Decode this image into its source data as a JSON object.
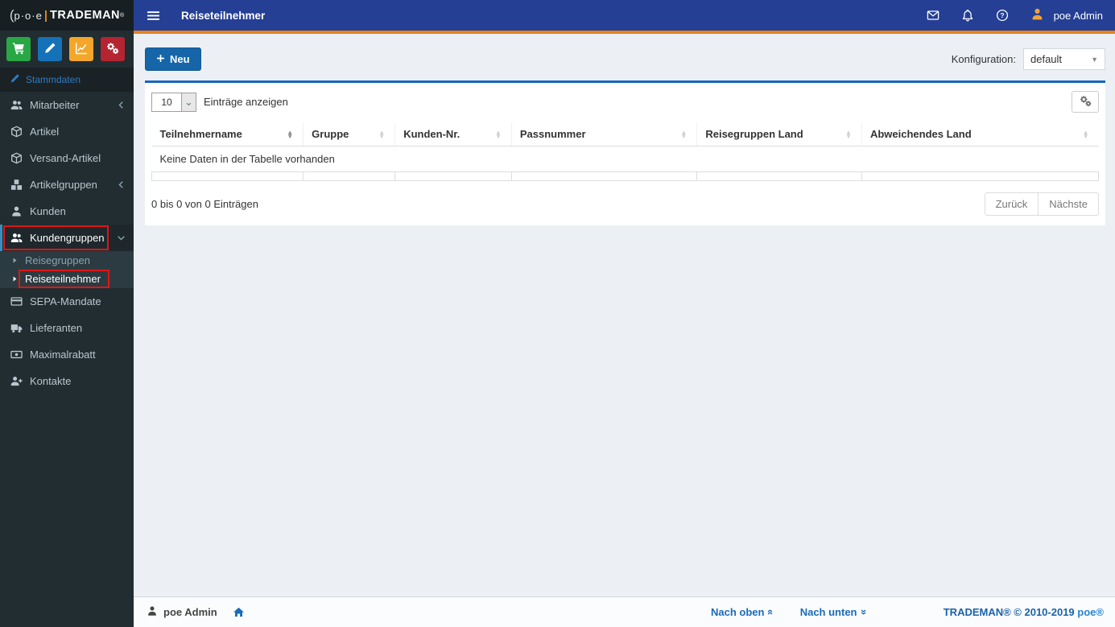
{
  "logo": {
    "paren": "(",
    "poe": "p·o·e",
    "brand": "TRADEMAN",
    "reg": "®"
  },
  "topbar": {
    "title": "Reiseteilnehmer",
    "user": "poe Admin",
    "icons": [
      "envelope-icon",
      "bell-icon",
      "question-icon"
    ]
  },
  "quick_buttons": [
    {
      "name": "cart-button",
      "icon": "cart",
      "color": "#2aa745"
    },
    {
      "name": "edit-button",
      "icon": "pencil",
      "color": "#1572b8"
    },
    {
      "name": "chart-button",
      "icon": "chart",
      "color": "#f4a62a"
    },
    {
      "name": "cogs-button",
      "icon": "cogs",
      "color": "#b52431"
    }
  ],
  "sidebar": {
    "header": "Stammdaten",
    "items": [
      {
        "label": "Mitarbeiter",
        "icon": "users",
        "chevron": "left"
      },
      {
        "label": "Artikel",
        "icon": "cube"
      },
      {
        "label": "Versand-Artikel",
        "icon": "cube"
      },
      {
        "label": "Artikelgruppen",
        "icon": "cubes",
        "chevron": "left"
      },
      {
        "label": "Kunden",
        "icon": "user"
      },
      {
        "label": "Kundengruppen",
        "icon": "users",
        "chevron": "down",
        "active": true,
        "annotated": true,
        "submenu": [
          {
            "label": "Reisegruppen"
          },
          {
            "label": "Reiseteilnehmer",
            "active": true,
            "annotated": true
          }
        ]
      },
      {
        "label": "SEPA-Mandate",
        "icon": "card"
      },
      {
        "label": "Lieferanten",
        "icon": "truck"
      },
      {
        "label": "Maximalrabatt",
        "icon": "money"
      },
      {
        "label": "Kontakte",
        "icon": "user-plus"
      }
    ]
  },
  "toolbar": {
    "new_label": "Neu",
    "config_label": "Konfiguration:",
    "config_value": "default"
  },
  "table": {
    "length_value": "10",
    "length_label": "Einträge anzeigen",
    "columns": [
      "Teilnehmername",
      "Gruppe",
      "Kunden-Nr.",
      "Passnummer",
      "Reisegruppen Land",
      "Abweichendes Land"
    ],
    "sorted_column": "Teilnehmername",
    "empty_text": "Keine Daten in der Tabelle vorhanden",
    "info": "0 bis 0 von 0 Einträgen",
    "prev_label": "Zurück",
    "next_label": "Nächste"
  },
  "footer": {
    "user": "poe Admin",
    "up_label": "Nach oben",
    "down_label": "Nach unten",
    "copyright": "TRADEMAN® © 2010-2019",
    "brand": "poe®"
  },
  "colors": {
    "topbar_blue": "#243f94",
    "accent_orange": "#e8821c",
    "sidebar_dark": "#222d32",
    "submenu_dark": "#2c3b41",
    "panel_border_blue": "#1565c0",
    "primary_button_blue": "#1565a8",
    "link_blue": "#1a6bb8",
    "annotation_red": "#e01515",
    "quick_green": "#2aa745",
    "quick_blue": "#1572b8",
    "quick_amber": "#f4a62a",
    "quick_red": "#b52431"
  }
}
